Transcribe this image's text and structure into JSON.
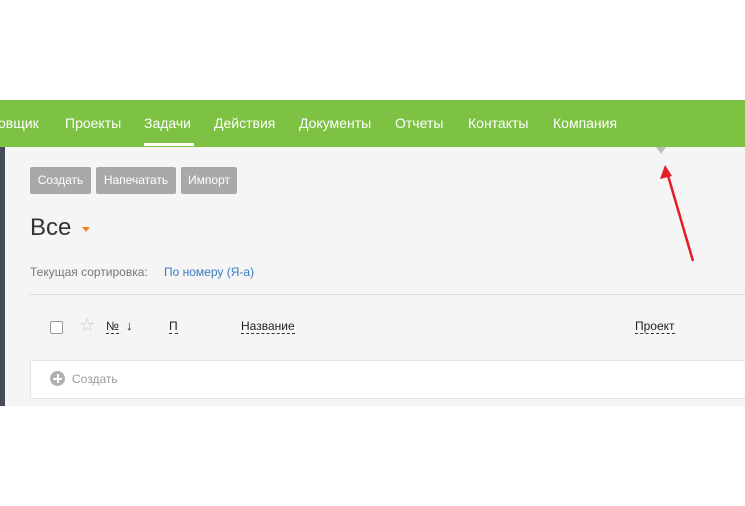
{
  "nav": {
    "items": [
      {
        "label": "овщик"
      },
      {
        "label": "Проекты"
      },
      {
        "label": "Задачи",
        "active": true
      },
      {
        "label": "Действия"
      },
      {
        "label": "Документы"
      },
      {
        "label": "Отчеты"
      },
      {
        "label": "Контакты"
      },
      {
        "label": "Компания"
      }
    ]
  },
  "toolbar": {
    "create_label": "Создать",
    "print_label": "Напечатать",
    "import_label": "Импорт"
  },
  "filter": {
    "title": "Все"
  },
  "sorting": {
    "label": "Текущая сортировка:",
    "value": "По номеру (Я-а)"
  },
  "table": {
    "columns": {
      "number": "№",
      "priority": "П",
      "name": "Название",
      "project": "Проект"
    },
    "sort_arrow": "↓"
  },
  "create_row": {
    "label": "Создать"
  },
  "icons": {
    "star": "star-icon",
    "plus": "plus-circle-icon",
    "arrow": "red-annotation-arrow"
  },
  "colors": {
    "nav_bg": "#7dc242",
    "button_bg": "#a9a9a9",
    "link": "#3a7bbf",
    "caret": "#f58220",
    "annotation": "#e41e26"
  }
}
